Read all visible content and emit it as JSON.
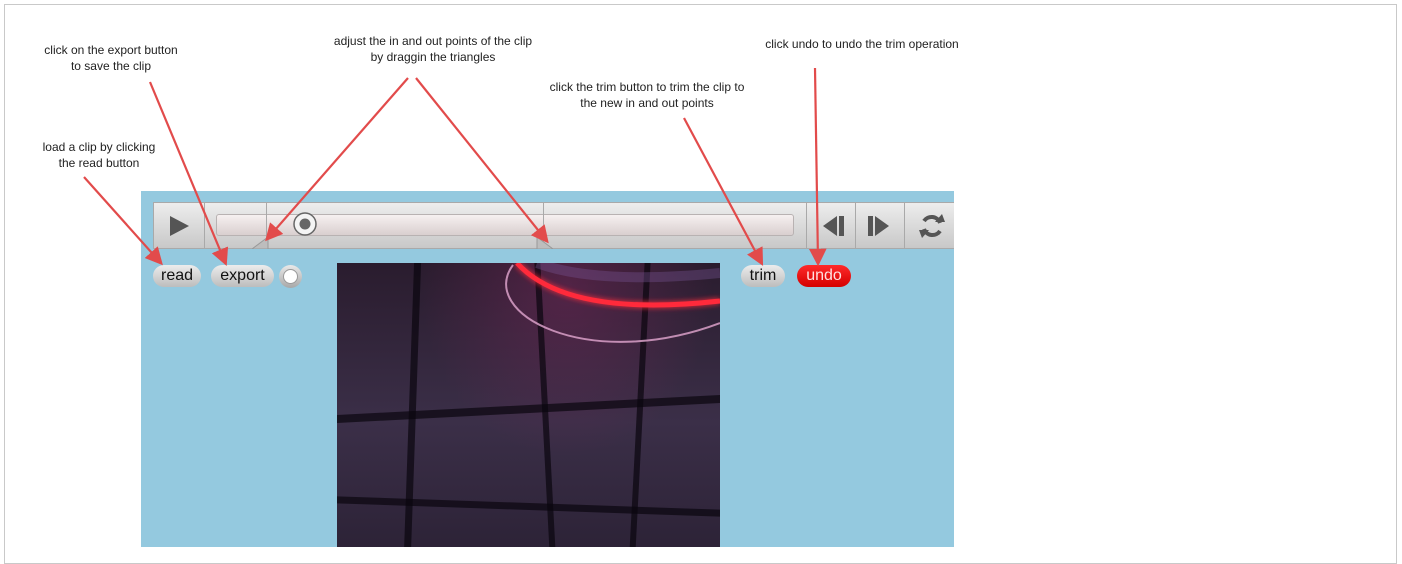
{
  "annotations": {
    "export": "click on the export button\nto save the clip",
    "adjust": "adjust the in and out points of the clip\nby draggin the triangles",
    "undo": "click undo to undo the trim operation",
    "trim": "click the trim button to trim the clip to\nthe new in and out points",
    "read": "load a clip by clicking\nthe read button"
  },
  "buttons": {
    "read": "read",
    "export": "export",
    "trim": "trim",
    "undo": "undo"
  },
  "icons": {
    "play": "play-icon",
    "playhead": "playhead-icon",
    "in_point": "in-point-triangle-icon",
    "out_point": "out-point-triangle-icon",
    "step_back": "step-back-icon",
    "step_forward": "step-forward-icon",
    "loop": "loop-icon"
  },
  "colors": {
    "panel": "#94c9df",
    "undo": "#e60000",
    "arrow": "#e24b4b"
  }
}
